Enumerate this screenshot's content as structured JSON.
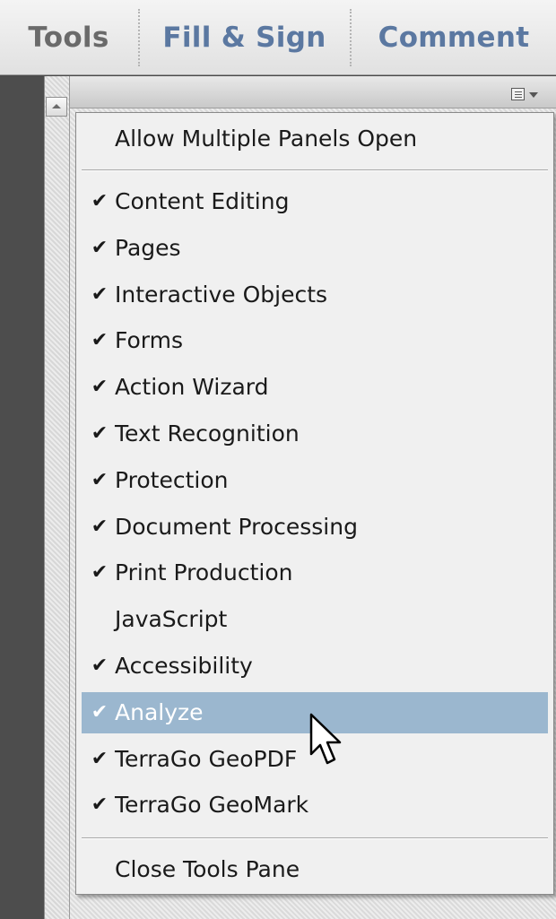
{
  "tabs": [
    {
      "label": "Tools"
    },
    {
      "label": "Fill & Sign"
    },
    {
      "label": "Comment"
    }
  ],
  "panel": {
    "options_icon": "panel-options-icon"
  },
  "menu": {
    "top_item": {
      "label": "Allow Multiple Panels Open",
      "checked": false
    },
    "items": [
      {
        "label": "Content Editing",
        "checked": true
      },
      {
        "label": "Pages",
        "checked": true
      },
      {
        "label": "Interactive Objects",
        "checked": true
      },
      {
        "label": "Forms",
        "checked": true
      },
      {
        "label": "Action Wizard",
        "checked": true
      },
      {
        "label": "Text Recognition",
        "checked": true
      },
      {
        "label": "Protection",
        "checked": true
      },
      {
        "label": "Document Processing",
        "checked": true
      },
      {
        "label": "Print Production",
        "checked": true
      },
      {
        "label": "JavaScript",
        "checked": false
      },
      {
        "label": "Accessibility",
        "checked": true
      },
      {
        "label": "Analyze",
        "checked": true,
        "highlighted": true
      },
      {
        "label": "TerraGo GeoPDF",
        "checked": true
      },
      {
        "label": "TerraGo GeoMark",
        "checked": true
      }
    ],
    "bottom_item": {
      "label": "Close Tools Pane",
      "checked": false
    },
    "check_glyph": "✔",
    "highlight_color": "#9bb7cf"
  }
}
